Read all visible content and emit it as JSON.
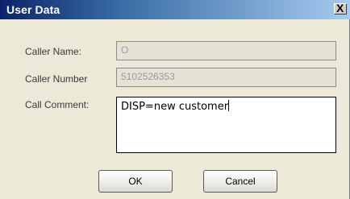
{
  "window": {
    "title": "User Data",
    "close_symbol": "X"
  },
  "form": {
    "caller_name": {
      "label": "Caller Name:",
      "value": "O"
    },
    "caller_number": {
      "label": "Caller Number",
      "value": "5102526353"
    },
    "call_comment": {
      "label": "Call Comment:",
      "value": "DISP=new customer"
    }
  },
  "buttons": {
    "ok_label": "OK",
    "cancel_label": "Cancel"
  }
}
